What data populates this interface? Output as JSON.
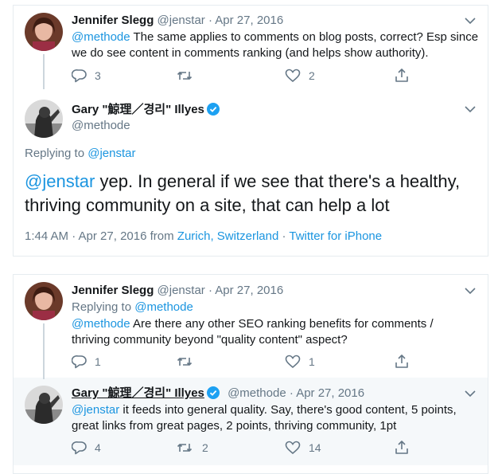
{
  "thread1": {
    "reply": {
      "name": "Jennifer Slegg",
      "handle": "@jenstar",
      "sep": "·",
      "date": "Apr 27, 2016",
      "mention": "@methode",
      "text_line1": " The same applies to comments on blog posts, correct?  Esp since",
      "text_line2": "we do see content in comments ranking (and helps show authority).",
      "reply_count": "3",
      "retweet_count": "",
      "like_count": "2"
    },
    "main": {
      "name": "Gary \"鯨理／경리\" Illyes",
      "handle": "@methode",
      "replying_label": "Replying to ",
      "replying_to": "@jenstar",
      "mention": "@jenstar",
      "text_line1": " yep. In general if we see that there's a healthy,",
      "text_line2": "thriving community on a site, that can help a lot",
      "time": "1:44 AM · Apr 27, 2016 from ",
      "location": "Zurich, Switzerland",
      "dot": " · ",
      "source": "Twitter for iPhone"
    }
  },
  "thread2": {
    "question": {
      "name": "Jennifer Slegg",
      "handle": "@jenstar",
      "sep": "·",
      "date": "Apr 27, 2016",
      "replying_label": "Replying to ",
      "replying_to": "@methode",
      "mention": "@methode",
      "text_line1": " Are there any other SEO ranking benefits for comments /",
      "text_line2": "thriving community beyond \"quality content\" aspect?",
      "reply_count": "1",
      "like_count": "1"
    },
    "answer": {
      "name": "Gary \"鯨理／경리\" Illyes",
      "handle": "@methode",
      "sep": "·",
      "date": "Apr 27, 2016",
      "mention": "@jenstar",
      "text_line1": " it feeds into general quality. Say, there's good content, 5 points,",
      "text_line2": "great links from great pages, 2 points, thriving community, 1pt",
      "reply_count": "4",
      "retweet_count": "2",
      "like_count": "14"
    }
  },
  "colors": {
    "accent": "#1b95e0",
    "muted": "#657786",
    "border": "#e6ecf0",
    "verified": "#1da1f2"
  },
  "icons": [
    "reply-icon",
    "retweet-icon",
    "like-icon",
    "share-icon",
    "chevron-down-icon",
    "verified-badge-icon"
  ]
}
